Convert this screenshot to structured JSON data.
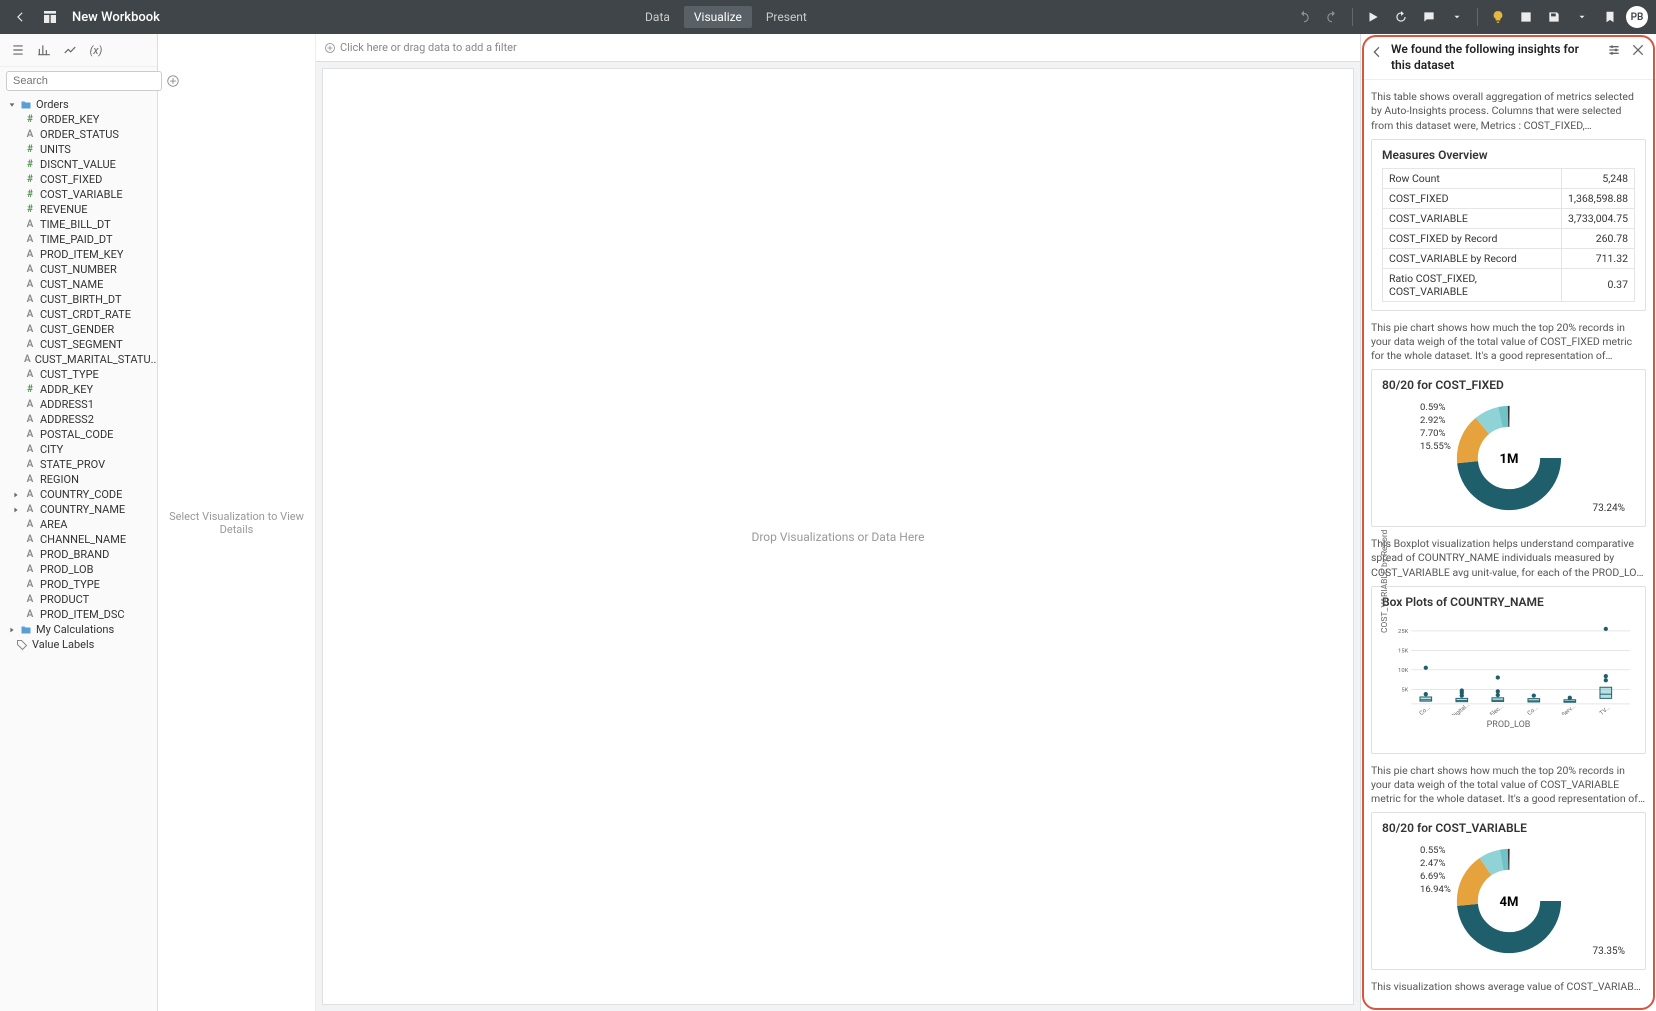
{
  "header": {
    "title": "New Workbook",
    "tabs": [
      "Data",
      "Visualize",
      "Present"
    ],
    "active_tab": 1,
    "avatar": "PB"
  },
  "left": {
    "search_placeholder": "Search",
    "root_folder": "Orders",
    "fields": [
      {
        "t": "num",
        "n": "ORDER_KEY"
      },
      {
        "t": "txt",
        "n": "ORDER_STATUS"
      },
      {
        "t": "num",
        "n": "UNITS"
      },
      {
        "t": "num",
        "n": "DISCNT_VALUE"
      },
      {
        "t": "num",
        "n": "COST_FIXED"
      },
      {
        "t": "num",
        "n": "COST_VARIABLE"
      },
      {
        "t": "num",
        "n": "REVENUE"
      },
      {
        "t": "txt",
        "n": "TIME_BILL_DT"
      },
      {
        "t": "txt",
        "n": "TIME_PAID_DT"
      },
      {
        "t": "txt",
        "n": "PROD_ITEM_KEY"
      },
      {
        "t": "txt",
        "n": "CUST_NUMBER"
      },
      {
        "t": "txt",
        "n": "CUST_NAME"
      },
      {
        "t": "txt",
        "n": "CUST_BIRTH_DT"
      },
      {
        "t": "txt",
        "n": "CUST_CRDT_RATE"
      },
      {
        "t": "txt",
        "n": "CUST_GENDER"
      },
      {
        "t": "txt",
        "n": "CUST_SEGMENT"
      },
      {
        "t": "txt",
        "n": "CUST_MARITAL_STATU..."
      },
      {
        "t": "txt",
        "n": "CUST_TYPE"
      },
      {
        "t": "num",
        "n": "ADDR_KEY"
      },
      {
        "t": "txt",
        "n": "ADDRESS1"
      },
      {
        "t": "txt",
        "n": "ADDRESS2"
      },
      {
        "t": "txt",
        "n": "POSTAL_CODE"
      },
      {
        "t": "txt",
        "n": "CITY"
      },
      {
        "t": "txt",
        "n": "STATE_PROV"
      },
      {
        "t": "txt",
        "n": "REGION"
      },
      {
        "t": "txt",
        "n": "COUNTRY_CODE",
        "exp": true
      },
      {
        "t": "txt",
        "n": "COUNTRY_NAME",
        "exp": true
      },
      {
        "t": "txt",
        "n": "AREA"
      },
      {
        "t": "txt",
        "n": "CHANNEL_NAME"
      },
      {
        "t": "txt",
        "n": "PROD_BRAND"
      },
      {
        "t": "txt",
        "n": "PROD_LOB"
      },
      {
        "t": "txt",
        "n": "PROD_TYPE"
      },
      {
        "t": "txt",
        "n": "PRODUCT"
      },
      {
        "t": "txt",
        "n": "PROD_ITEM_DSC"
      }
    ],
    "my_calc": "My Calculations",
    "value_labels": "Value Labels"
  },
  "viz_hint": "Select Visualization to View Details",
  "filter_hint": "Click here or drag data to add a filter",
  "canvas_hint": "Drop Visualizations or Data Here",
  "insights": {
    "header": "We found the following insights for this dataset",
    "overview_desc": "This table shows overall aggregation of metrics selected by Auto-Insights process. Columns that were selected from this dataset were, Metrics : COST_FIXED, COST_VARIABLE, Dimensions : CUST_MARITAL_STATUS,...",
    "overview_title": "Measures Overview",
    "overview_rows": [
      {
        "k": "Row Count",
        "v": "5,248"
      },
      {
        "k": "COST_FIXED",
        "v": "1,368,598.88"
      },
      {
        "k": "COST_VARIABLE",
        "v": "3,733,004.75"
      },
      {
        "k": "COST_FIXED by Record",
        "v": "260.78"
      },
      {
        "k": "COST_VARIABLE by Record",
        "v": "711.32"
      },
      {
        "k": "Ratio COST_FIXED, COST_VARIABLE",
        "v": "0.37"
      }
    ],
    "pie1_desc": "This pie chart shows how much the top 20% records in your data weigh of the total value of COST_FIXED metric for the whole dataset. It's a good representation of importance of top individuals in your data. Slices of th...",
    "pie1_title": "80/20 for COST_FIXED",
    "pie1_center": "1M",
    "pie1_labels": [
      "0.59%",
      "2.92%",
      "7.70%",
      "15.55%"
    ],
    "pie1_big": "73.24%",
    "box_desc": "This Boxplot visualization helps understand comparative spread of COUNTRY_NAME individuals measured by COST_VARIABLE avg unit-value, for each of the PROD_LOB. We detected interesting variances...",
    "box_title": "Box Plots of COUNTRY_NAME",
    "box_ylab": "COST_VARIABLE by Record",
    "box_xlab": "PROD_LOB",
    "box_cats": [
      "Co...",
      "Digital...",
      "Elec...",
      "Co...",
      "Serv...",
      "TV..."
    ],
    "box_yticks": [
      "25K",
      "15K",
      "10K",
      "5K"
    ],
    "pie2_desc": "This pie chart shows how much the top 20% records in your data weigh of the total value of COST_VARIABLE metric for the whole dataset. It's a good representation of importance of top individuals in your data. Slice...",
    "pie2_title": "80/20 for COST_VARIABLE",
    "pie2_center": "4M",
    "pie2_labels": [
      "0.55%",
      "2.47%",
      "6.69%",
      "16.94%"
    ],
    "pie2_big": "73.35%",
    "tail_desc": "This visualization shows average value of COST_VARIABLE by record for"
  },
  "chart_data": [
    {
      "type": "table",
      "title": "Measures Overview",
      "rows": [
        [
          "Row Count",
          5248
        ],
        [
          "COST_FIXED",
          1368598.88
        ],
        [
          "COST_VARIABLE",
          3733004.75
        ],
        [
          "COST_FIXED by Record",
          260.78
        ],
        [
          "COST_VARIABLE by Record",
          711.32
        ],
        [
          "Ratio COST_FIXED, COST_VARIABLE",
          0.37
        ]
      ]
    },
    {
      "type": "pie",
      "title": "80/20 for COST_FIXED",
      "center_total": "1M",
      "slices": [
        {
          "label": "0.59%",
          "value": 0.59,
          "color": "#38a3a5"
        },
        {
          "label": "2.92%",
          "value": 2.92,
          "color": "#6fc2c5"
        },
        {
          "label": "7.70%",
          "value": 7.7,
          "color": "#8fd3d6"
        },
        {
          "label": "15.55%",
          "value": 15.55,
          "color": "#e6a23c"
        },
        {
          "label": "73.24%",
          "value": 73.24,
          "color": "#1f5f6b"
        }
      ]
    },
    {
      "type": "boxplot",
      "title": "Box Plots of COUNTRY_NAME",
      "xlabel": "PROD_LOB",
      "ylabel": "COST_VARIABLE by Record",
      "ylim": [
        0,
        28000
      ],
      "categories": [
        "Co...",
        "Digital...",
        "Elec...",
        "Co...",
        "Serv...",
        "TV..."
      ],
      "series": [
        {
          "cat": "Co...",
          "q1": 1000,
          "med": 1500,
          "q3": 2500,
          "outliers": [
            13000,
            3500
          ]
        },
        {
          "cat": "Digital...",
          "q1": 800,
          "med": 1200,
          "q3": 2000,
          "outliers": [
            3000,
            4000,
            4800
          ]
        },
        {
          "cat": "Elec...",
          "q1": 900,
          "med": 1300,
          "q3": 2200,
          "outliers": [
            3200,
            4500,
            9500
          ]
        },
        {
          "cat": "Co...",
          "q1": 700,
          "med": 1100,
          "q3": 1900,
          "outliers": [
            3000
          ]
        },
        {
          "cat": "Serv...",
          "q1": 600,
          "med": 900,
          "q3": 1500,
          "outliers": [
            2200
          ]
        },
        {
          "cat": "TV...",
          "q1": 2000,
          "med": 3500,
          "q3": 6000,
          "outliers": [
            27000,
            10000,
            8500
          ]
        }
      ]
    },
    {
      "type": "pie",
      "title": "80/20 for COST_VARIABLE",
      "center_total": "4M",
      "slices": [
        {
          "label": "0.55%",
          "value": 0.55,
          "color": "#38a3a5"
        },
        {
          "label": "2.47%",
          "value": 2.47,
          "color": "#6fc2c5"
        },
        {
          "label": "6.69%",
          "value": 6.69,
          "color": "#8fd3d6"
        },
        {
          "label": "16.94%",
          "value": 16.94,
          "color": "#e6a23c"
        },
        {
          "label": "73.35%",
          "value": 73.35,
          "color": "#1f5f6b"
        }
      ]
    }
  ]
}
